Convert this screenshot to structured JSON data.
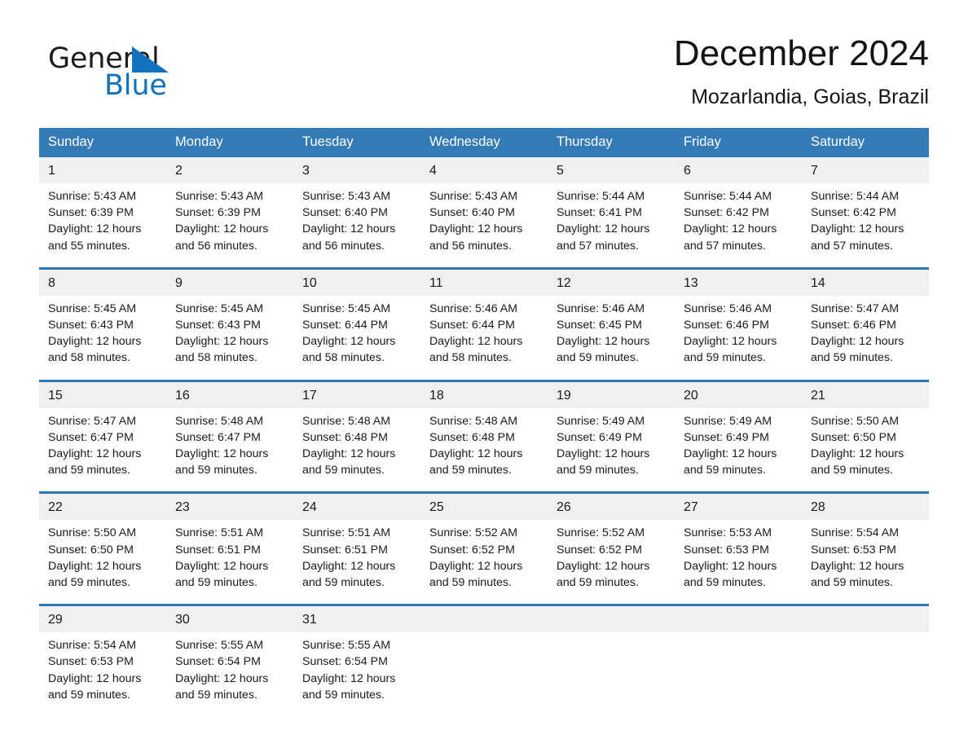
{
  "brand": {
    "name_part1": "General",
    "name_part2": "Blue",
    "accent_color": "#1272bd",
    "triangle_icon": "triangle-icon"
  },
  "header": {
    "month_title": "December 2024",
    "location": "Mozarlandia, Goias, Brazil"
  },
  "theme": {
    "header_bg": "#337ab7",
    "row_divider": "#2f76b3",
    "daynum_bg": "#f0f0f0",
    "text": "#1a1a1a"
  },
  "weekdays": [
    "Sunday",
    "Monday",
    "Tuesday",
    "Wednesday",
    "Thursday",
    "Friday",
    "Saturday"
  ],
  "weeks": [
    [
      {
        "day": "1",
        "info": "Sunrise: 5:43 AM\nSunset: 6:39 PM\nDaylight: 12 hours and 55 minutes."
      },
      {
        "day": "2",
        "info": "Sunrise: 5:43 AM\nSunset: 6:39 PM\nDaylight: 12 hours and 56 minutes."
      },
      {
        "day": "3",
        "info": "Sunrise: 5:43 AM\nSunset: 6:40 PM\nDaylight: 12 hours and 56 minutes."
      },
      {
        "day": "4",
        "info": "Sunrise: 5:43 AM\nSunset: 6:40 PM\nDaylight: 12 hours and 56 minutes."
      },
      {
        "day": "5",
        "info": "Sunrise: 5:44 AM\nSunset: 6:41 PM\nDaylight: 12 hours and 57 minutes."
      },
      {
        "day": "6",
        "info": "Sunrise: 5:44 AM\nSunset: 6:42 PM\nDaylight: 12 hours and 57 minutes."
      },
      {
        "day": "7",
        "info": "Sunrise: 5:44 AM\nSunset: 6:42 PM\nDaylight: 12 hours and 57 minutes."
      }
    ],
    [
      {
        "day": "8",
        "info": "Sunrise: 5:45 AM\nSunset: 6:43 PM\nDaylight: 12 hours and 58 minutes."
      },
      {
        "day": "9",
        "info": "Sunrise: 5:45 AM\nSunset: 6:43 PM\nDaylight: 12 hours and 58 minutes."
      },
      {
        "day": "10",
        "info": "Sunrise: 5:45 AM\nSunset: 6:44 PM\nDaylight: 12 hours and 58 minutes."
      },
      {
        "day": "11",
        "info": "Sunrise: 5:46 AM\nSunset: 6:44 PM\nDaylight: 12 hours and 58 minutes."
      },
      {
        "day": "12",
        "info": "Sunrise: 5:46 AM\nSunset: 6:45 PM\nDaylight: 12 hours and 59 minutes."
      },
      {
        "day": "13",
        "info": "Sunrise: 5:46 AM\nSunset: 6:46 PM\nDaylight: 12 hours and 59 minutes."
      },
      {
        "day": "14",
        "info": "Sunrise: 5:47 AM\nSunset: 6:46 PM\nDaylight: 12 hours and 59 minutes."
      }
    ],
    [
      {
        "day": "15",
        "info": "Sunrise: 5:47 AM\nSunset: 6:47 PM\nDaylight: 12 hours and 59 minutes."
      },
      {
        "day": "16",
        "info": "Sunrise: 5:48 AM\nSunset: 6:47 PM\nDaylight: 12 hours and 59 minutes."
      },
      {
        "day": "17",
        "info": "Sunrise: 5:48 AM\nSunset: 6:48 PM\nDaylight: 12 hours and 59 minutes."
      },
      {
        "day": "18",
        "info": "Sunrise: 5:48 AM\nSunset: 6:48 PM\nDaylight: 12 hours and 59 minutes."
      },
      {
        "day": "19",
        "info": "Sunrise: 5:49 AM\nSunset: 6:49 PM\nDaylight: 12 hours and 59 minutes."
      },
      {
        "day": "20",
        "info": "Sunrise: 5:49 AM\nSunset: 6:49 PM\nDaylight: 12 hours and 59 minutes."
      },
      {
        "day": "21",
        "info": "Sunrise: 5:50 AM\nSunset: 6:50 PM\nDaylight: 12 hours and 59 minutes."
      }
    ],
    [
      {
        "day": "22",
        "info": "Sunrise: 5:50 AM\nSunset: 6:50 PM\nDaylight: 12 hours and 59 minutes."
      },
      {
        "day": "23",
        "info": "Sunrise: 5:51 AM\nSunset: 6:51 PM\nDaylight: 12 hours and 59 minutes."
      },
      {
        "day": "24",
        "info": "Sunrise: 5:51 AM\nSunset: 6:51 PM\nDaylight: 12 hours and 59 minutes."
      },
      {
        "day": "25",
        "info": "Sunrise: 5:52 AM\nSunset: 6:52 PM\nDaylight: 12 hours and 59 minutes."
      },
      {
        "day": "26",
        "info": "Sunrise: 5:52 AM\nSunset: 6:52 PM\nDaylight: 12 hours and 59 minutes."
      },
      {
        "day": "27",
        "info": "Sunrise: 5:53 AM\nSunset: 6:53 PM\nDaylight: 12 hours and 59 minutes."
      },
      {
        "day": "28",
        "info": "Sunrise: 5:54 AM\nSunset: 6:53 PM\nDaylight: 12 hours and 59 minutes."
      }
    ],
    [
      {
        "day": "29",
        "info": "Sunrise: 5:54 AM\nSunset: 6:53 PM\nDaylight: 12 hours and 59 minutes."
      },
      {
        "day": "30",
        "info": "Sunrise: 5:55 AM\nSunset: 6:54 PM\nDaylight: 12 hours and 59 minutes."
      },
      {
        "day": "31",
        "info": "Sunrise: 5:55 AM\nSunset: 6:54 PM\nDaylight: 12 hours and 59 minutes."
      },
      {
        "day": "",
        "info": ""
      },
      {
        "day": "",
        "info": ""
      },
      {
        "day": "",
        "info": ""
      },
      {
        "day": "",
        "info": ""
      }
    ]
  ]
}
